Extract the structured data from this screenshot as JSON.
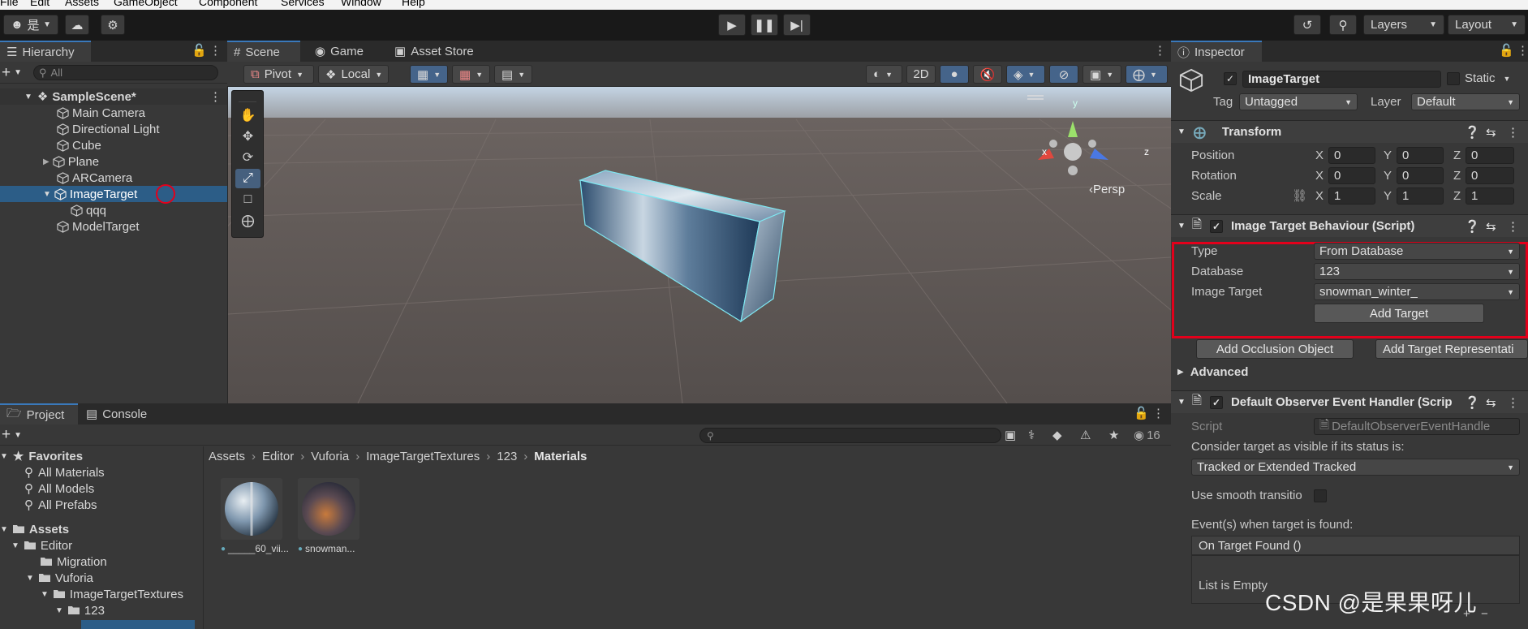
{
  "menu": [
    "File",
    "Edit",
    "Assets",
    "GameObject",
    "Component",
    "Services",
    "Window",
    "Help"
  ],
  "toolbar": {
    "account_label": "是",
    "layers_label": "Layers",
    "layout_label": "Layout"
  },
  "hierarchy": {
    "tab": "Hierarchy",
    "search_placeholder": "All",
    "scene": "SampleScene*",
    "items": [
      {
        "label": "Main Camera"
      },
      {
        "label": "Directional Light"
      },
      {
        "label": "Cube"
      },
      {
        "label": "Plane"
      },
      {
        "label": "ARCamera"
      },
      {
        "label": "ImageTarget"
      },
      {
        "label": "qqq"
      },
      {
        "label": "ModelTarget"
      }
    ]
  },
  "scene_tabs": {
    "scene": "Scene",
    "game": "Game",
    "asset_store": "Asset Store"
  },
  "scene_toolbar": {
    "pivot": "Pivot",
    "local": "Local",
    "mode_2d": "2D"
  },
  "viewport": {
    "persp_label": "Persp",
    "axis_x": "x",
    "axis_y": "y",
    "axis_z": "z"
  },
  "inspector": {
    "tab": "Inspector",
    "object_name": "ImageTarget",
    "static_label": "Static",
    "tag_label": "Tag",
    "tag_value": "Untagged",
    "layer_label": "Layer",
    "layer_value": "Default",
    "transform": {
      "title": "Transform",
      "rows": [
        {
          "label": "Position",
          "x": "0",
          "y": "0",
          "z": "0"
        },
        {
          "label": "Rotation",
          "x": "0",
          "y": "0",
          "z": "0"
        },
        {
          "label": "Scale",
          "x": "1",
          "y": "1",
          "z": "1"
        }
      ]
    },
    "itb": {
      "title": "Image Target Behaviour (Script)",
      "type_label": "Type",
      "type_value": "From Database",
      "database_label": "Database",
      "database_value": "123",
      "image_target_label": "Image Target",
      "image_target_value": "snowman_winter_",
      "add_target": "Add Target",
      "add_occlusion": "Add Occlusion Object",
      "add_representation": "Add Target Representati"
    },
    "advanced": "Advanced",
    "observer": {
      "title": "Default Observer Event Handler (Scrip",
      "script_label": "Script",
      "script_value": "DefaultObserverEventHandle",
      "consider_label": "Consider target as visible if its status is:",
      "status_value": "Tracked or Extended Tracked",
      "smooth_label": "Use smooth transitio",
      "events_label": "Event(s) when target is found:",
      "on_found": "On Target Found ()",
      "list_empty": "List is Empty"
    }
  },
  "project": {
    "tab_project": "Project",
    "tab_console": "Console",
    "badge_count": "16",
    "favorites": "Favorites",
    "fav_items": [
      "All Materials",
      "All Models",
      "All Prefabs"
    ],
    "assets": "Assets",
    "tree": [
      "Editor",
      "Migration",
      "Vuforia",
      "ImageTargetTextures",
      "123"
    ],
    "breadcrumb": [
      "Assets",
      "Editor",
      "Vuforia",
      "ImageTargetTextures",
      "123",
      "Materials"
    ],
    "files": [
      {
        "name": "_____60_vii..."
      },
      {
        "name": "snowman..."
      }
    ]
  },
  "watermark": "CSDN @是果果呀儿",
  "colors": {
    "highlight_box": "#e3001b",
    "selection": "#2c5d87",
    "accent": "#3a79bb"
  }
}
